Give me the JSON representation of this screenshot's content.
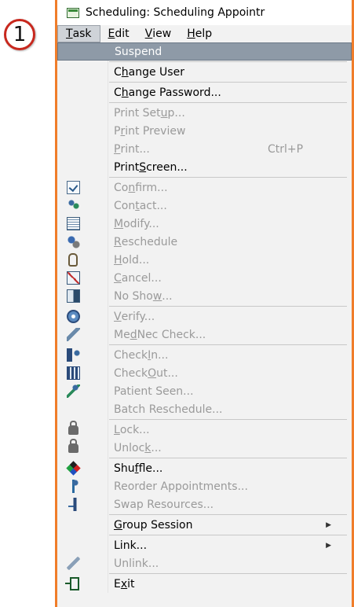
{
  "callout": {
    "number": "1"
  },
  "window": {
    "title": "Scheduling: Scheduling Appointr",
    "icon": "calendar-app-icon",
    "border_color": "#f07d2a"
  },
  "menubar": {
    "items": [
      {
        "label": "Task",
        "u": "T",
        "rest": "ask",
        "active": true
      },
      {
        "label": "Edit",
        "u": "E",
        "rest": "dit"
      },
      {
        "label": "View",
        "u": "V",
        "rest": "iew"
      },
      {
        "label": "Help",
        "u": "H",
        "rest": "elp"
      }
    ]
  },
  "menu": {
    "suspend": {
      "label": "Suspend"
    },
    "change_user": {
      "a": "C",
      "u": "h",
      "b": "ange User"
    },
    "change_password": {
      "a": "C",
      "u": "h",
      "b": "ange Password..."
    },
    "print_setup": {
      "a": "Print Set",
      "u": "u",
      "b": "p..."
    },
    "print_preview": {
      "a": "P",
      "u": "r",
      "b": "int Preview"
    },
    "print": {
      "u": "P",
      "b": "rint...",
      "shortcut": "Ctrl+P"
    },
    "print_screen": {
      "a": "Print ",
      "u": "S",
      "b": "creen..."
    },
    "confirm": {
      "a": "Co",
      "u": "n",
      "b": "firm..."
    },
    "contact": {
      "a": "Con",
      "u": "t",
      "b": "act..."
    },
    "modify": {
      "u": "M",
      "b": "odify..."
    },
    "reschedule": {
      "u": "R",
      "b": "eschedule"
    },
    "hold": {
      "u": "H",
      "b": "old..."
    },
    "cancel": {
      "u": "C",
      "b": "ancel..."
    },
    "no_show": {
      "a": "No Sho",
      "u": "w",
      "b": "..."
    },
    "verify": {
      "u": "V",
      "b": "erify..."
    },
    "med_nec": {
      "a": "Me",
      "u": "d",
      "b": " Nec Check..."
    },
    "check_in": {
      "a": "Check ",
      "u": "I",
      "b": "n..."
    },
    "check_out": {
      "a": "Check ",
      "u": "O",
      "b": "ut..."
    },
    "patient_seen": {
      "label": "Patient Seen..."
    },
    "batch_reschedule": {
      "label": "Batch Reschedule..."
    },
    "lock": {
      "u": "L",
      "b": "ock..."
    },
    "unlock": {
      "a": "Unloc",
      "u": "k",
      "b": "..."
    },
    "shuffle": {
      "a": "Shu",
      "u": "f",
      "b": "fle..."
    },
    "reorder": {
      "label": "Reorder Appointments..."
    },
    "swap": {
      "label": "Swap Resources..."
    },
    "group_session": {
      "u": "G",
      "b": "roup Session"
    },
    "link": {
      "label": "Link..."
    },
    "unlink": {
      "label": "Unlink..."
    },
    "exit": {
      "a": "E",
      "u": "x",
      "b": "it"
    }
  }
}
